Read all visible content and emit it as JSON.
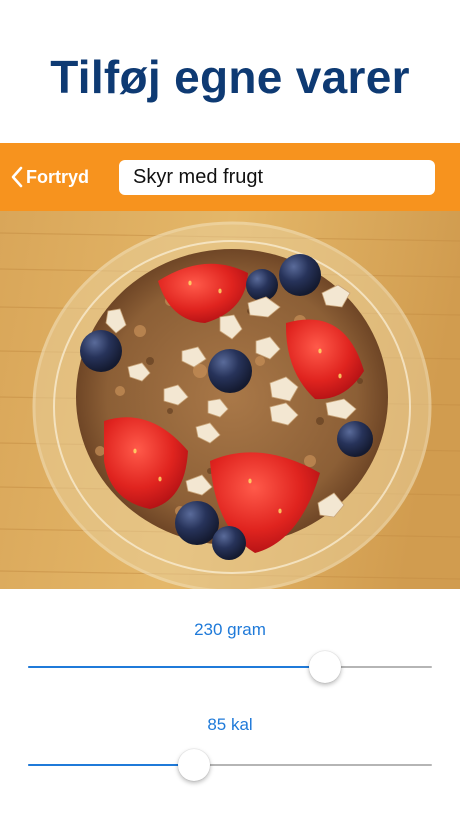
{
  "title": "Tilføj egne varer",
  "toolbar": {
    "back_label": "Fortryd",
    "back_icon": "chevron-left-icon",
    "name_value": "Skyr med frugt"
  },
  "photo": {
    "subject": "skyr-bowl-photo"
  },
  "weight_slider": {
    "label": "230 gram",
    "fraction": 0.735
  },
  "calorie_slider": {
    "label": "85 kal",
    "fraction": 0.41
  },
  "colors": {
    "title": "#0e3a73",
    "toolbar": "#f7931e",
    "accent": "#1f7ad9",
    "track": "#b5b5b5"
  }
}
